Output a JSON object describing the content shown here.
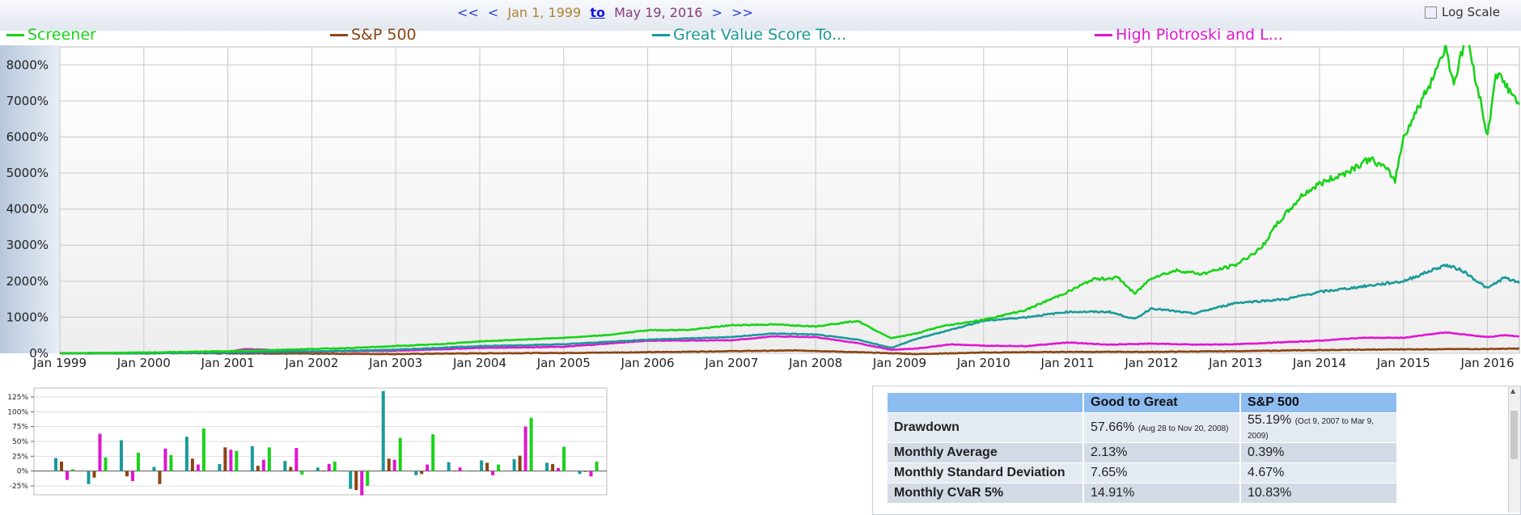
{
  "nav": {
    "back_all": "<<",
    "back": "<",
    "start_date": "Jan 1, 1999",
    "to": "to",
    "end_date": "May 19, 2016",
    "forward": ">",
    "forward_all": ">>"
  },
  "log_scale": {
    "label": "Log Scale",
    "checked": false
  },
  "legend": [
    {
      "label": "Screener",
      "color": "#19d319"
    },
    {
      "label": "S&P 500",
      "color": "#8b4513"
    },
    {
      "label": "Great Value Score To...",
      "color": "#1a9a9a"
    },
    {
      "label": "High Piotroski and L...",
      "color": "#e016d0"
    }
  ],
  "chart_data": [
    {
      "type": "line",
      "x_tick_labels": [
        "Jan 1999",
        "Jan 2000",
        "Jan 2001",
        "Jan 2002",
        "Jan 2003",
        "Jan 2004",
        "Jan 2005",
        "Jan 2006",
        "Jan 2007",
        "Jan 2008",
        "Jan 2009",
        "Jan 2010",
        "Jan 2011",
        "Jan 2012",
        "Jan 2013",
        "Jan 2014",
        "Jan 2015",
        "Jan 2016"
      ],
      "y_tick_labels": [
        "0%",
        "1000%",
        "2000%",
        "3000%",
        "4000%",
        "5000%",
        "6000%",
        "7000%",
        "8000%"
      ],
      "xlim": [
        1999.0,
        2016.38
      ],
      "ylim": [
        0,
        8500
      ],
      "grid": true,
      "legend_position": "top",
      "series": [
        {
          "name": "Screener",
          "color": "#19d319",
          "x": [
            1999.0,
            1999.5,
            2000.0,
            2000.5,
            2001.0,
            2001.5,
            2002.0,
            2002.5,
            2003.0,
            2003.5,
            2004.0,
            2004.5,
            2005.0,
            2005.5,
            2006.0,
            2006.5,
            2007.0,
            2007.5,
            2008.0,
            2008.5,
            2008.7,
            2008.9,
            2009.2,
            2009.5,
            2010.0,
            2010.5,
            2011.0,
            2011.3,
            2011.6,
            2011.8,
            2012.0,
            2012.3,
            2012.6,
            2013.0,
            2013.3,
            2013.5,
            2013.8,
            2014.0,
            2014.3,
            2014.6,
            2014.8,
            2014.9,
            2015.0,
            2015.3,
            2015.5,
            2015.6,
            2015.75,
            2015.9,
            2016.0,
            2016.1,
            2016.2,
            2016.38
          ],
          "y": [
            0,
            10,
            20,
            40,
            60,
            90,
            120,
            150,
            200,
            250,
            330,
            380,
            430,
            500,
            640,
            650,
            780,
            800,
            750,
            900,
            650,
            420,
            550,
            750,
            930,
            1200,
            1700,
            2050,
            2100,
            1650,
            2100,
            2300,
            2200,
            2450,
            2900,
            3600,
            4400,
            4700,
            5000,
            5400,
            5100,
            4800,
            6000,
            7400,
            8500,
            7500,
            8800,
            7200,
            6000,
            7800,
            7500,
            6900
          ]
        },
        {
          "name": "S&P 500",
          "color": "#8b4513",
          "x": [
            1999.0,
            2000.0,
            2001.0,
            2002.0,
            2003.0,
            2004.0,
            2005.0,
            2006.0,
            2007.0,
            2007.8,
            2008.5,
            2009.2,
            2010.0,
            2011.0,
            2012.0,
            2013.0,
            2014.0,
            2015.0,
            2016.0,
            2016.38
          ],
          "y": [
            0,
            10,
            0,
            -10,
            -20,
            0,
            10,
            30,
            60,
            80,
            30,
            -20,
            20,
            40,
            40,
            60,
            90,
            110,
            120,
            130
          ]
        },
        {
          "name": "Great Value Score To...",
          "color": "#1a9a9a",
          "x": [
            1999.0,
            2000.0,
            2001.0,
            2002.0,
            2003.0,
            2004.0,
            2005.0,
            2006.0,
            2007.0,
            2007.5,
            2008.0,
            2008.5,
            2008.9,
            2009.2,
            2009.6,
            2010.0,
            2010.5,
            2011.0,
            2011.5,
            2011.8,
            2012.0,
            2012.5,
            2013.0,
            2013.3,
            2013.6,
            2014.0,
            2014.5,
            2015.0,
            2015.5,
            2015.7,
            2016.0,
            2016.2,
            2016.38
          ],
          "y": [
            0,
            0,
            20,
            50,
            100,
            200,
            250,
            380,
            450,
            550,
            520,
            380,
            150,
            400,
            650,
            900,
            1000,
            1150,
            1150,
            950,
            1250,
            1100,
            1400,
            1450,
            1500,
            1700,
            1850,
            2000,
            2450,
            2300,
            1800,
            2100,
            1950
          ]
        },
        {
          "name": "High Piotroski and L...",
          "color": "#e016d0",
          "x": [
            1999.0,
            2000.0,
            2001.0,
            2001.2,
            2002.0,
            2003.0,
            2004.0,
            2005.0,
            2006.0,
            2007.0,
            2007.5,
            2008.0,
            2008.5,
            2008.9,
            2009.2,
            2009.6,
            2010.0,
            2010.5,
            2011.0,
            2011.5,
            2012.0,
            2012.5,
            2013.0,
            2013.5,
            2014.0,
            2014.5,
            2015.0,
            2015.5,
            2016.0,
            2016.2,
            2016.38
          ],
          "y": [
            0,
            0,
            30,
            120,
            50,
            70,
            150,
            180,
            350,
            360,
            470,
            450,
            280,
            100,
            130,
            250,
            210,
            200,
            300,
            240,
            270,
            240,
            250,
            300,
            350,
            430,
            430,
            580,
            450,
            500,
            470
          ]
        }
      ]
    },
    {
      "type": "bar",
      "y_tick_labels": [
        "-25%",
        "0%",
        "25%",
        "50%",
        "75%",
        "100%",
        "125%"
      ],
      "ylim": [
        -40,
        140
      ],
      "grid": true,
      "series_colors": [
        "#1a9a9a",
        "#8b4513",
        "#e016d0",
        "#19d319"
      ],
      "groups": [
        [
          22,
          16,
          -15,
          3
        ],
        [
          -22,
          -11,
          63,
          23
        ],
        [
          52,
          -9,
          -17,
          31
        ],
        [
          7,
          -22,
          38,
          27
        ],
        [
          58,
          21,
          11,
          72
        ],
        [
          12,
          40,
          36,
          34
        ],
        [
          42,
          9,
          19,
          40
        ],
        [
          17,
          7,
          39,
          -6
        ],
        [
          6,
          1,
          12,
          16
        ],
        [
          -30,
          -32,
          -41,
          -25
        ],
        [
          135,
          21,
          19,
          56
        ],
        [
          -7,
          -5,
          11,
          62
        ],
        [
          15,
          1,
          6,
          1
        ],
        [
          18,
          14,
          -7,
          11
        ],
        [
          20,
          26,
          75,
          90
        ],
        [
          14,
          12,
          5,
          41
        ],
        [
          -5,
          0,
          -9,
          16
        ]
      ]
    }
  ],
  "stats": {
    "headers": [
      "",
      "Good to Great",
      "S&P 500"
    ],
    "rows": [
      {
        "label": "Drawdown",
        "v1": "57.66%",
        "v1_note": "(Aug 28 to Nov 20, 2008)",
        "v2": "55.19%",
        "v2_note": "(Oct 9, 2007 to Mar 9, 2009)"
      },
      {
        "label": "Monthly Average",
        "v1": "2.13%",
        "v1_note": "",
        "v2": "0.39%",
        "v2_note": ""
      },
      {
        "label": "Monthly Standard Deviation",
        "v1": "7.65%",
        "v1_note": "",
        "v2": "4.67%",
        "v2_note": ""
      },
      {
        "label": "Monthly CVaR 5%",
        "v1": "14.91%",
        "v1_note": "",
        "v2": "10.83%",
        "v2_note": ""
      }
    ]
  }
}
